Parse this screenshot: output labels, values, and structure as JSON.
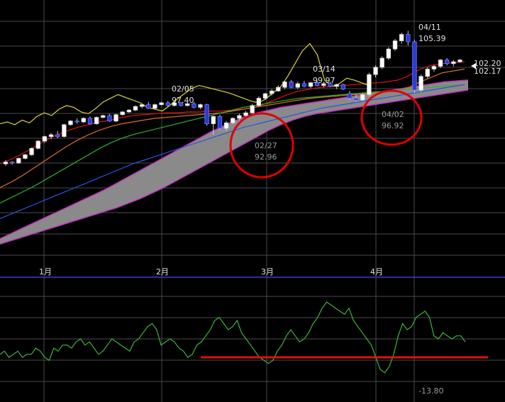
{
  "colors": {
    "background": "#000000",
    "grid": "#4a4a4a",
    "separator": "#3a3ad8",
    "label": "#e0e0e0",
    "muted_label": "#9a9a9a",
    "candle_up_fill": "#ffffff",
    "candle_down_fill": "#2a3bd6",
    "cloud_fill": "#8a8a8a",
    "cloud_edge": "#c030c0",
    "circle": "#e00000",
    "oscillator": "#3cb43c",
    "red_line": "#e01010",
    "lagging_span": "#d8d830"
  },
  "chart_data": [
    {
      "type": "candlestick",
      "x_tick_labels": [
        "1月",
        "2月",
        "3月",
        "4月"
      ],
      "y_range": [
        80,
        108
      ],
      "annotations": [
        {
          "date": "02/05",
          "value": "97.40"
        },
        {
          "date": "02/27",
          "value": "92.96"
        },
        {
          "date": "03/14",
          "value": "99.97"
        },
        {
          "date": "04/02",
          "value": "96.92"
        },
        {
          "date": "04/11",
          "value": "105.39"
        }
      ],
      "price_labels": [
        "102.20",
        "102.17"
      ],
      "highlight_circles": 2,
      "series": [
        {
          "kind": "lagging-span",
          "color": "#d8d830",
          "values": [
            95.2,
            95.4,
            95.1,
            95.6,
            95.3,
            96.0,
            96.4,
            96.1,
            96.8,
            97.2,
            97.0,
            96.5,
            96.3,
            96.9,
            97.6,
            98.0,
            98.4,
            98.1,
            97.8,
            97.5,
            97.0,
            96.8,
            96.6,
            97.2,
            97.9,
            98.5,
            99.1,
            99.4,
            99.2,
            99.0,
            98.8,
            98.6,
            98.3,
            98.0,
            97.7,
            97.5,
            97.9,
            98.6,
            99.2,
            100.4,
            101.8,
            103.2,
            104.0,
            102.8,
            100.0,
            99.3,
            99.6,
            100.2,
            100.0,
            99.7,
            99.4
          ]
        },
        {
          "kind": "red-ma",
          "color": "#e01010",
          "values": [
            90.8,
            91.3,
            91.9,
            92.6,
            93.3,
            93.9,
            94.4,
            94.8,
            95.1,
            95.4,
            95.6,
            95.9,
            96.1,
            96.2,
            96.3,
            96.4,
            96.4,
            96.5,
            96.5,
            96.6,
            96.6,
            96.7,
            96.8,
            97.0,
            97.4,
            97.9,
            98.4,
            98.8,
            99.0,
            99.2,
            99.3,
            99.4,
            99.5,
            99.6,
            99.7,
            99.8,
            100.0,
            100.5,
            101.2,
            101.6,
            101.8,
            101.9,
            102.0
          ]
        },
        {
          "kind": "orange-ma",
          "color": "#e07020",
          "values": [
            88.2,
            88.8,
            89.5,
            90.3,
            91.1,
            91.9,
            92.7,
            93.4,
            94.0,
            94.5,
            94.9,
            95.2,
            95.4,
            95.6,
            95.8,
            95.9,
            96.0,
            96.1,
            96.2,
            96.3,
            96.4,
            96.6,
            96.8,
            97.0,
            97.2,
            97.4,
            97.6,
            97.8,
            98.0,
            98.1,
            98.2,
            98.3,
            98.4,
            98.5,
            98.6,
            98.7,
            98.8,
            99.2,
            99.8,
            100.3,
            100.8,
            101.0,
            101.2
          ]
        },
        {
          "kind": "green-ma",
          "color": "#2fb02f",
          "values": [
            86.5,
            87.1,
            87.7,
            88.3,
            89.0,
            89.7,
            90.4,
            91.1,
            91.8,
            92.5,
            93.1,
            93.6,
            94.0,
            94.3,
            94.6,
            94.9,
            95.2,
            95.5,
            95.8,
            96.1,
            96.4,
            96.7,
            97.0,
            97.2,
            97.4,
            97.6,
            97.8,
            98.0,
            98.1,
            98.2,
            98.3,
            98.4,
            98.5,
            98.6,
            98.7,
            98.8,
            98.9,
            99.0,
            99.1,
            99.2,
            99.3,
            99.4,
            99.5
          ]
        },
        {
          "kind": "blue-ma",
          "color": "#3050e0",
          "values": [
            84.8,
            85.3,
            85.8,
            86.3,
            86.8,
            87.3,
            87.8,
            88.3,
            88.8,
            89.3,
            89.8,
            90.3,
            90.8,
            91.2,
            91.6,
            92.0,
            92.4,
            92.8,
            93.2,
            93.6,
            94.0,
            94.4,
            94.8,
            95.1,
            95.4,
            95.7,
            96.0,
            96.3,
            96.6,
            96.9,
            97.1,
            97.3,
            97.5,
            97.7,
            97.9,
            98.1,
            98.3,
            98.5,
            98.7,
            98.9,
            99.1,
            99.3,
            99.5
          ]
        },
        {
          "kind": "cloud-upper",
          "color": "#c030c0",
          "values": [
            82.6,
            83.2,
            83.8,
            84.4,
            85.0,
            85.6,
            86.2,
            86.8,
            87.4,
            88.0,
            88.7,
            89.4,
            90.1,
            90.8,
            91.5,
            92.2,
            92.9,
            93.6,
            94.3,
            94.9,
            95.5,
            96.0,
            96.4,
            96.7,
            97.0,
            97.2,
            97.4,
            97.6,
            97.8,
            98.0,
            98.2,
            98.4,
            98.6,
            98.8,
            99.0,
            99.2,
            99.4,
            99.6,
            99.8,
            99.9,
            100.0
          ]
        },
        {
          "kind": "cloud-lower",
          "color": "#c030c0",
          "values": [
            82.0,
            82.4,
            82.8,
            83.2,
            83.6,
            84.0,
            84.4,
            84.8,
            85.2,
            85.6,
            86.0,
            86.5,
            87.0,
            87.6,
            88.2,
            88.9,
            89.6,
            90.3,
            91.0,
            91.7,
            92.4,
            93.1,
            93.8,
            94.5,
            95.1,
            95.6,
            96.0,
            96.3,
            96.5,
            96.7,
            96.9,
            97.1,
            97.3,
            97.5,
            97.7,
            97.9,
            98.1,
            98.3,
            98.5,
            98.7,
            98.9
          ]
        }
      ],
      "candles": [
        [
          90.8,
          91.2,
          90.6,
          91.0
        ],
        [
          91.0,
          91.1,
          90.7,
          90.9
        ],
        [
          90.9,
          91.5,
          90.8,
          91.4
        ],
        [
          91.4,
          91.9,
          91.3,
          91.8
        ],
        [
          91.8,
          92.6,
          91.7,
          92.5
        ],
        [
          92.5,
          93.4,
          92.4,
          93.3
        ],
        [
          93.3,
          93.9,
          93.1,
          93.8
        ],
        [
          93.8,
          94.2,
          93.5,
          94.0
        ],
        [
          94.0,
          94.4,
          93.6,
          93.8
        ],
        [
          93.8,
          95.2,
          93.7,
          95.1
        ],
        [
          95.1,
          95.6,
          95.0,
          95.5
        ],
        [
          95.5,
          95.8,
          95.2,
          95.4
        ],
        [
          95.4,
          95.9,
          95.3,
          95.8
        ],
        [
          95.8,
          96.0,
          95.1,
          95.2
        ],
        [
          95.2,
          96.0,
          95.1,
          95.9
        ],
        [
          95.9,
          96.2,
          95.8,
          96.1
        ],
        [
          96.1,
          96.3,
          95.4,
          95.5
        ],
        [
          95.5,
          96.3,
          95.4,
          96.2
        ],
        [
          96.2,
          96.6,
          96.1,
          96.5
        ],
        [
          96.5,
          96.8,
          96.4,
          96.7
        ],
        [
          96.7,
          97.2,
          96.6,
          97.1
        ],
        [
          97.1,
          97.4,
          96.9,
          97.3
        ],
        [
          97.3,
          97.6,
          96.8,
          96.9
        ],
        [
          96.9,
          97.4,
          96.8,
          97.3
        ],
        [
          97.3,
          97.6,
          97.2,
          97.5
        ],
        [
          97.5,
          97.7,
          97.1,
          97.2
        ],
        [
          97.2,
          97.6,
          97.1,
          97.5
        ],
        [
          97.5,
          97.6,
          97.1,
          97.2
        ],
        [
          97.2,
          97.5,
          97.1,
          97.4
        ],
        [
          97.4,
          97.6,
          96.9,
          97.0
        ],
        [
          97.0,
          97.4,
          96.8,
          97.3
        ],
        [
          97.3,
          97.4,
          95.0,
          95.2
        ],
        [
          95.2,
          96.1,
          94.0,
          96.0
        ],
        [
          96.0,
          96.2,
          94.5,
          94.7
        ],
        [
          94.7,
          95.5,
          94.4,
          95.3
        ],
        [
          95.3,
          95.9,
          95.2,
          95.8
        ],
        [
          95.8,
          96.3,
          95.6,
          96.1
        ],
        [
          96.1,
          96.6,
          96.0,
          96.4
        ],
        [
          96.4,
          97.4,
          96.3,
          97.2
        ],
        [
          97.2,
          98.2,
          97.1,
          98.0
        ],
        [
          98.0,
          98.6,
          97.8,
          98.5
        ],
        [
          98.5,
          99.0,
          98.3,
          98.8
        ],
        [
          98.8,
          99.4,
          98.7,
          99.2
        ],
        [
          99.2,
          99.9,
          99.0,
          99.8
        ],
        [
          99.8,
          100.0,
          99.1,
          99.2
        ],
        [
          99.2,
          99.8,
          99.0,
          99.6
        ],
        [
          99.6,
          99.9,
          99.2,
          99.3
        ],
        [
          99.3,
          99.8,
          99.1,
          99.7
        ],
        [
          99.7,
          99.9,
          99.3,
          99.4
        ],
        [
          99.4,
          99.8,
          99.2,
          99.6
        ],
        [
          99.6,
          99.8,
          99.2,
          99.3
        ],
        [
          99.3,
          99.6,
          99.0,
          99.5
        ],
        [
          99.5,
          99.6,
          98.9,
          99.0
        ],
        [
          98.5,
          98.8,
          97.8,
          98.0
        ],
        [
          98.0,
          98.4,
          97.6,
          97.8
        ],
        [
          97.8,
          98.6,
          97.7,
          98.4
        ],
        [
          98.4,
          100.8,
          98.2,
          100.6
        ],
        [
          100.6,
          101.6,
          100.3,
          101.4
        ],
        [
          101.4,
          102.6,
          101.2,
          102.4
        ],
        [
          102.4,
          103.6,
          102.2,
          103.4
        ],
        [
          103.4,
          104.5,
          103.2,
          104.3
        ],
        [
          104.3,
          105.2,
          104.0,
          105.0
        ],
        [
          105.0,
          105.39,
          103.8,
          104.2
        ],
        [
          104.2,
          104.4,
          98.6,
          98.9
        ],
        [
          98.9,
          100.6,
          98.7,
          100.4
        ],
        [
          100.4,
          101.4,
          100.2,
          101.2
        ],
        [
          101.2,
          101.7,
          100.9,
          101.5
        ],
        [
          101.5,
          102.3,
          101.3,
          102.2
        ],
        [
          102.2,
          102.4,
          101.6,
          101.8
        ],
        [
          101.8,
          102.2,
          101.5,
          102.0
        ],
        [
          102.0,
          102.3,
          101.9,
          102.2
        ]
      ]
    },
    {
      "type": "line",
      "y_label": "-13.80",
      "oscillator": [
        7,
        8,
        6,
        7,
        8,
        6,
        7,
        7,
        9,
        8,
        6,
        5,
        9,
        8,
        10,
        10,
        9,
        11,
        12,
        10,
        11,
        9,
        7,
        8,
        10,
        12,
        11,
        10,
        9,
        8,
        11,
        12,
        14,
        16,
        17,
        15,
        10,
        11,
        12,
        11,
        9,
        8,
        6,
        7,
        10,
        11,
        13,
        15,
        18,
        19,
        17,
        15,
        16,
        18,
        14,
        12,
        10,
        8,
        6,
        5,
        4,
        5,
        8,
        10,
        13,
        15,
        13,
        11,
        12,
        14,
        17,
        19,
        22,
        24,
        23,
        22,
        21,
        20,
        22,
        18,
        16,
        14,
        12,
        10,
        6,
        2,
        1,
        3,
        7,
        13,
        17,
        15,
        16,
        19,
        20,
        21,
        19,
        13,
        12,
        14,
        13,
        12,
        13,
        13,
        11
      ]
    }
  ]
}
